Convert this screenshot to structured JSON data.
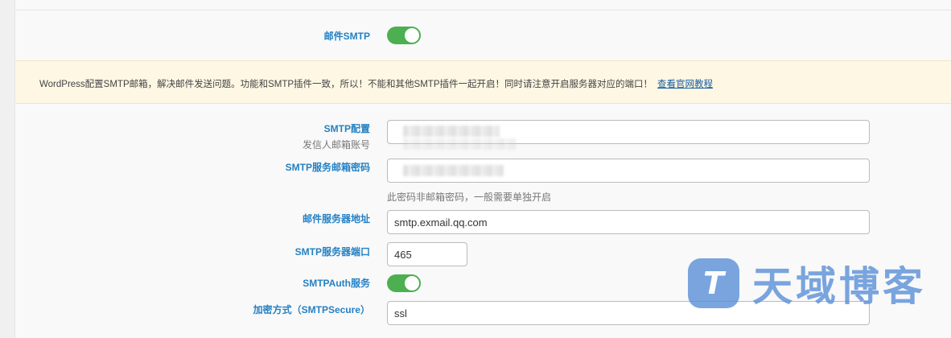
{
  "smtp_enable": {
    "label": "邮件SMTP",
    "enabled": true
  },
  "notice": {
    "text": "WordPress配置SMTP邮箱，解决邮件发送问题。功能和SMTP插件一致，所以！不能和其他SMTP插件一起开启！同时请注意开启服务器对应的端口！",
    "link": "查看官网教程"
  },
  "fields": {
    "sender": {
      "label": "SMTP配置",
      "sublabel": "发信人邮箱账号",
      "value": ""
    },
    "password": {
      "label": "SMTP服务邮箱密码",
      "value": "",
      "hint": "此密码非邮箱密码，一般需要单独开启"
    },
    "host": {
      "label": "邮件服务器地址",
      "value": "smtp.exmail.qq.com"
    },
    "port": {
      "label": "SMTP服务器端口",
      "value": "465"
    },
    "auth": {
      "label": "SMTPAuth服务",
      "enabled": true
    },
    "secure": {
      "label": "加密方式（SMTPSecure）",
      "value": "ssl"
    }
  },
  "watermark": {
    "text": "天域博客"
  },
  "colors": {
    "accent": "#2481c4",
    "toggle_on": "#4caf50",
    "notice_bg": "#fdf7e4",
    "link": "#1a5ea0"
  }
}
